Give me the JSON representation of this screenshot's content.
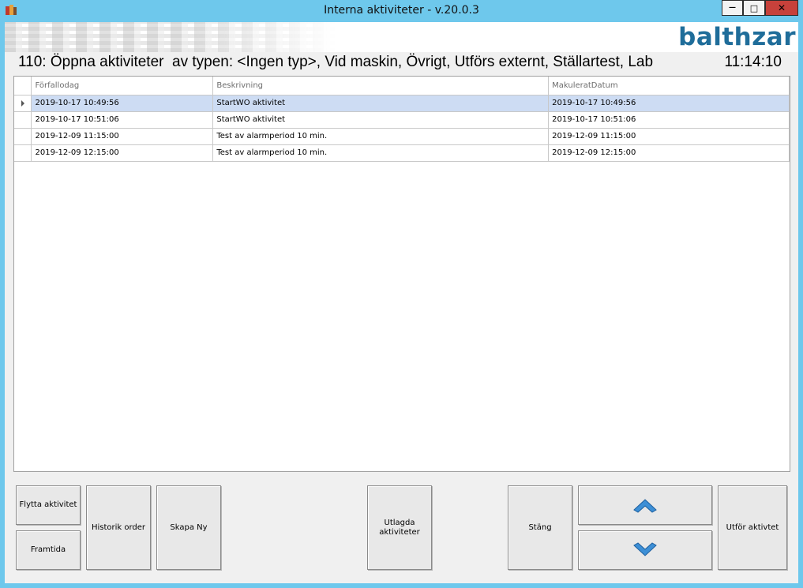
{
  "window": {
    "title": "Interna aktiviteter - v.20.0.3",
    "minimize_glyph": "—",
    "maximize_glyph": "□",
    "close_glyph": "✕"
  },
  "banner": {
    "logo_text": "balthzar",
    "logo_color": "#1f6d9a"
  },
  "heading": {
    "text": "110: Öppna aktiviteter  av typen: <Ingen typ>, Vid maskin, Övrigt, Utförs externt, Ställartest, Lab",
    "time": "11:14:10"
  },
  "grid": {
    "columns": [
      "Förfallodag",
      "Beskrivning",
      "MakuleratDatum"
    ],
    "rows": [
      {
        "due": "2019-10-17 10:49:56",
        "description": "StartWO aktivitet",
        "cancelled": "2019-10-17 10:49:56",
        "selected": true
      },
      {
        "due": "2019-10-17 10:51:06",
        "description": "StartWO aktivitet",
        "cancelled": "2019-10-17 10:51:06",
        "selected": false
      },
      {
        "due": "2019-12-09 11:15:00",
        "description": "Test av alarmperiod 10 min.",
        "cancelled": "2019-12-09 11:15:00",
        "selected": false
      },
      {
        "due": "2019-12-09 12:15:00",
        "description": "Test av alarmperiod 10 min.",
        "cancelled": "2019-12-09 12:15:00",
        "selected": false
      }
    ],
    "selection_color": "#cddcf3"
  },
  "buttons": {
    "move_activity": "Flytta aktivitet",
    "future": "Framtida",
    "order_history": "Historik order",
    "create_new": "Skapa Ny",
    "posted_activities": "Utlagda\naktiviteter",
    "close": "Stäng",
    "perform_activity": "Utför aktivtet",
    "scroll_up_icon": "chevron-up-icon",
    "scroll_down_icon": "chevron-down-icon"
  },
  "colors": {
    "titlebar": "#6ec8ec",
    "close_button": "#c7413b",
    "arrow_blue": "#3d8fd6"
  }
}
